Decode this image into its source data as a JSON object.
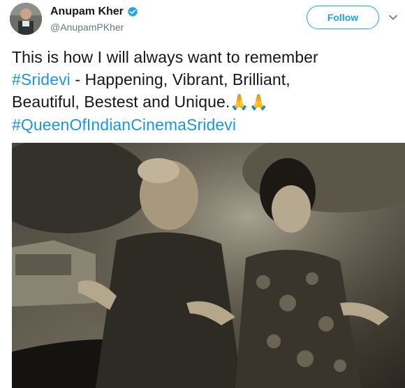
{
  "user": {
    "display_name": "Anupam Kher",
    "handle": "@AnupamPKher",
    "verified": true
  },
  "actions": {
    "follow_label": "Follow"
  },
  "tweet": {
    "line1": "This is how I will always want to remember",
    "hashtag1": "#Sridevi",
    "line2": " - Happening, Vibrant, Brilliant,",
    "line3": "Beautiful, Bestest and Unique.",
    "emoji": "🙏🙏",
    "hashtag2": "#QueenOfIndianCinemaSridevi"
  },
  "icons": {
    "verified": "verified-badge-icon",
    "menu": "chevron-down-icon"
  },
  "colors": {
    "accent": "#1da1f2",
    "hashtag": "#1b95e0",
    "text": "#14171a",
    "muted": "#657786"
  }
}
